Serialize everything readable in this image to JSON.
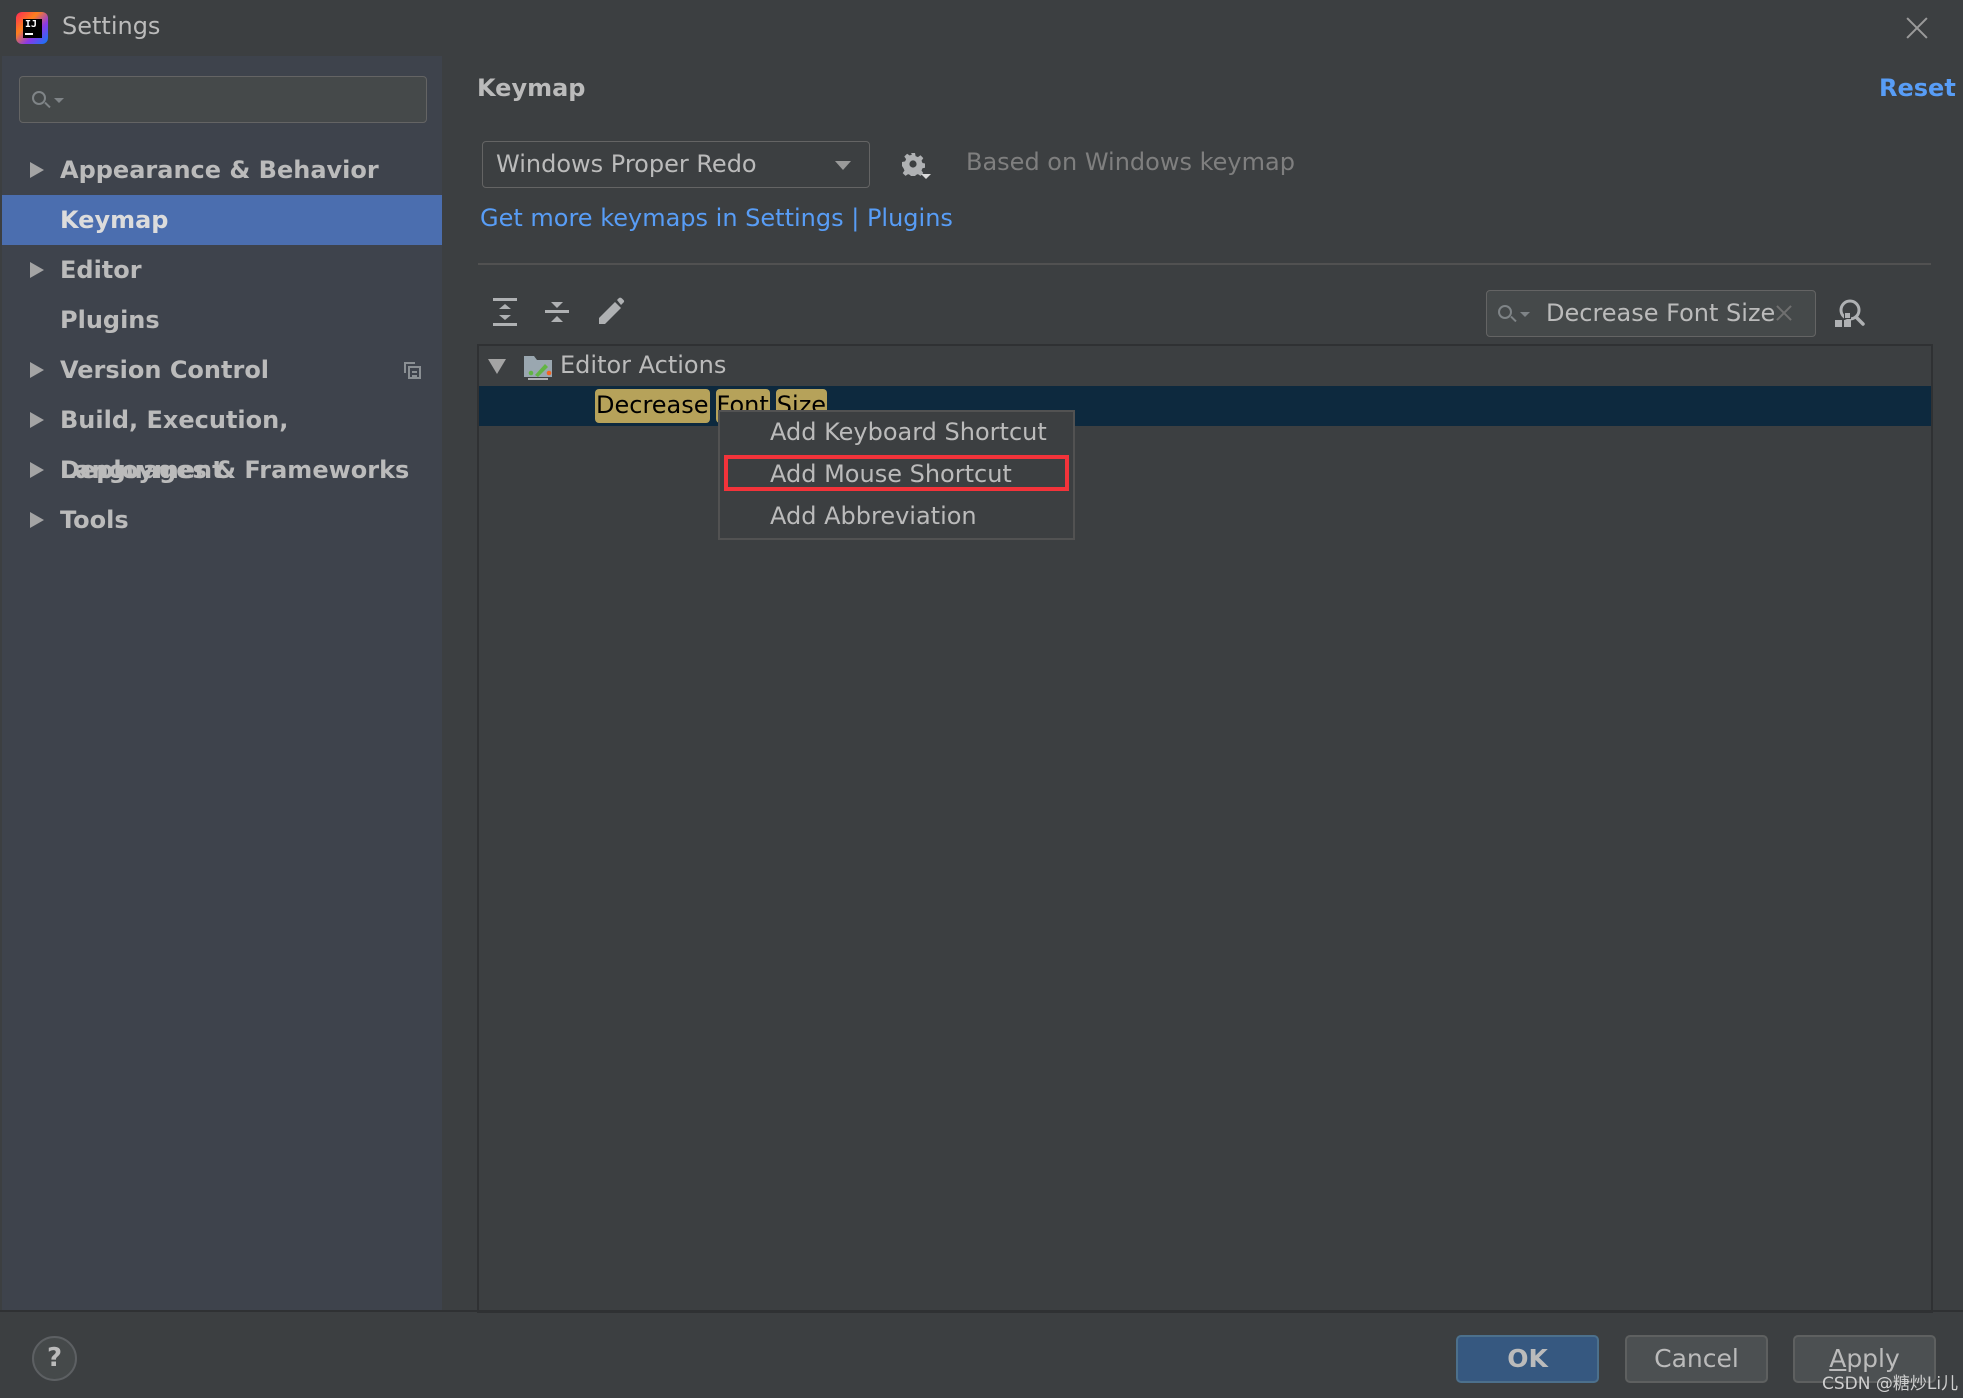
{
  "window": {
    "title": "Settings",
    "logo_text": "IJ",
    "close_icon": "close-icon"
  },
  "sidebar": {
    "search": {
      "value": "",
      "placeholder": ""
    },
    "items": [
      {
        "label": "Appearance & Behavior",
        "expandable": true,
        "selected": false
      },
      {
        "label": "Keymap",
        "expandable": false,
        "selected": true
      },
      {
        "label": "Editor",
        "expandable": true,
        "selected": false
      },
      {
        "label": "Plugins",
        "expandable": false,
        "selected": false
      },
      {
        "label": "Version Control",
        "expandable": true,
        "selected": false,
        "trailing_icon": "project-level-icon"
      },
      {
        "label": "Build, Execution, Deployment",
        "expandable": true,
        "selected": false
      },
      {
        "label": "Languages & Frameworks",
        "expandable": true,
        "selected": false
      },
      {
        "label": "Tools",
        "expandable": true,
        "selected": false
      }
    ]
  },
  "main": {
    "title": "Keymap",
    "reset_label": "Reset",
    "keymap_select": {
      "value": "Windows Proper Redo"
    },
    "based_on": "Based on Windows keymap",
    "get_more_link": "Get more keymaps in Settings | Plugins",
    "toolbar": {
      "expand_all": "expand-all-icon",
      "collapse_all": "collapse-all-icon",
      "edit": "edit-icon"
    },
    "filter": {
      "value": "Decrease Font Size",
      "placeholder": ""
    },
    "tree": {
      "group": {
        "label": "Editor Actions",
        "expanded": true
      },
      "action": {
        "highlighted_words": [
          "Decrease",
          "Font",
          "Size"
        ],
        "selected": true
      }
    },
    "context_menu": {
      "items": [
        {
          "label": "Add Keyboard Shortcut"
        },
        {
          "label": "Add Mouse Shortcut",
          "annotated": true
        },
        {
          "label": "Add Abbreviation"
        }
      ]
    }
  },
  "footer": {
    "help_label": "?",
    "ok_label": "OK",
    "cancel_label": "Cancel",
    "apply_label_mnemonic": "A",
    "apply_label_rest": "pply"
  },
  "watermark": "CSDN @糖炒Li儿",
  "colors": {
    "accent_link": "#589df6",
    "selection": "#4b6eaf",
    "tree_selection": "#0d293e",
    "search_highlight": "#b6a25a",
    "annotation": "#f3333a",
    "ok_button": "#365880"
  }
}
